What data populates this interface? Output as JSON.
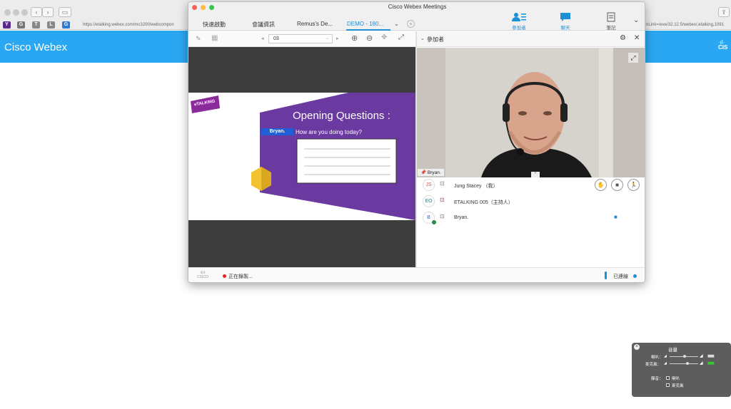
{
  "browser": {
    "url_left": "https://etalking.webex.com/mc3200/webcompon",
    "url_right": "nLink=/exe/32.12.5/webex/,etalking,1091",
    "bookmarks": [
      "Y",
      "G",
      "T",
      "L",
      "G"
    ]
  },
  "banner": {
    "title": "Cisco Webex",
    "logo": "cisco"
  },
  "window": {
    "title": "Cisco Webex Meetings",
    "tabs": [
      "快速啟動",
      "會議資訊",
      "Remus's De...",
      "DEMO - 180..."
    ],
    "active_tab": "DEMO - 180...",
    "toolbar_buttons": [
      {
        "label": "參加者",
        "icon": "participants-icon"
      },
      {
        "label": "聊天",
        "icon": "chat-icon"
      },
      {
        "label": "筆記",
        "icon": "notes-icon"
      }
    ]
  },
  "content_toolbar": {
    "page": "03"
  },
  "slide": {
    "logo_text": "eTALKING",
    "title": "Opening Questions :",
    "name_tag": "Bryan.",
    "question": "How are you doing today?"
  },
  "participants_panel": {
    "header": "參加者",
    "video_label": "Bryan.",
    "people": [
      {
        "initials": "JS",
        "name": "Jung Stacey （我）"
      },
      {
        "initials": "EO",
        "name": "ETALKING 005（主持人）"
      },
      {
        "initials": "B",
        "name": "Bryan."
      }
    ]
  },
  "status_bar": {
    "logo": "cisco",
    "recording": "正在錄製...",
    "connection": "已連線"
  },
  "volume_panel": {
    "title": "音量",
    "speaker_label": "喇叭：",
    "mic_label": "麥克風：",
    "mute_label": "靜音：",
    "mute_speaker": "喇叭",
    "mute_mic": "麥克風"
  },
  "colors": {
    "accent": "#1b8fd8",
    "banner": "#2aa7f2",
    "slide_purple": "#6a3aa0",
    "hexagon": "#f2c230"
  }
}
